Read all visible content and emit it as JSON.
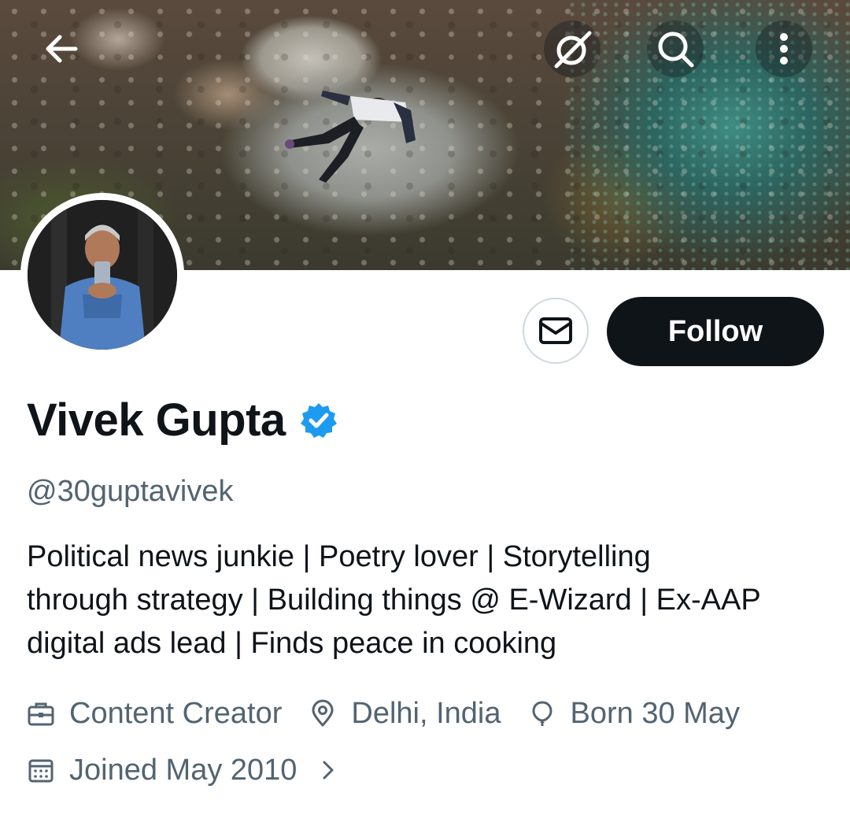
{
  "header": {
    "back_icon": "arrow-left-icon",
    "grok_icon": "grok-icon",
    "search_icon": "search-icon",
    "more_icon": "more-vertical-icon"
  },
  "profile": {
    "name": "Vivek Gupta",
    "verified": true,
    "handle": "@30guptavivek",
    "bio_lines": [
      "Political news junkie | Poetry lover | Storytelling",
      "through strategy | Building things @ E-Wizard | Ex-AAP",
      "digital ads lead | Finds peace in cooking"
    ],
    "category": "Content Creator",
    "location": "Delhi, India",
    "birthday": "Born 30 May",
    "joined": "Joined May 2010"
  },
  "actions": {
    "message_icon": "envelope-icon",
    "follow_label": "Follow"
  },
  "colors": {
    "text_primary": "#0f1419",
    "text_secondary": "#536471",
    "verified_blue": "#1d9bf0",
    "button_dark": "#0f1419",
    "border": "#cfd9de"
  }
}
